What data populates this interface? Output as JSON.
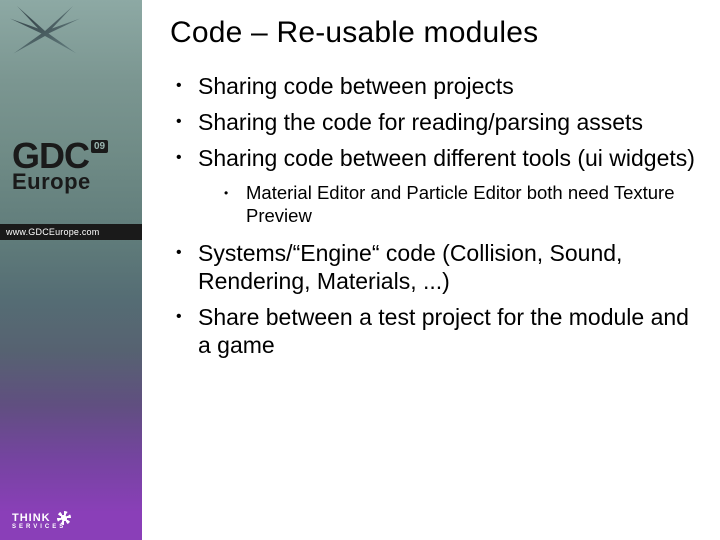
{
  "sidebar": {
    "logo_main": "GDC",
    "logo_badge": "09",
    "logo_sub": "Europe",
    "url": "www.GDCEurope.com",
    "footer_brand": "THINK",
    "footer_sub": "SERVICES"
  },
  "slide": {
    "title": "Code – Re-usable modules",
    "bullets": [
      {
        "text": "Sharing code between projects"
      },
      {
        "text": "Sharing the code for reading/parsing assets"
      },
      {
        "text": "Sharing code between different tools (ui widgets)",
        "sub": [
          {
            "text": "Material Editor and Particle Editor both need Texture Preview"
          }
        ]
      },
      {
        "text": "Systems/“Engine“ code (Collision, Sound, Rendering, Materials, ...)"
      },
      {
        "text": "Share between a test project for the module and a game"
      }
    ]
  }
}
